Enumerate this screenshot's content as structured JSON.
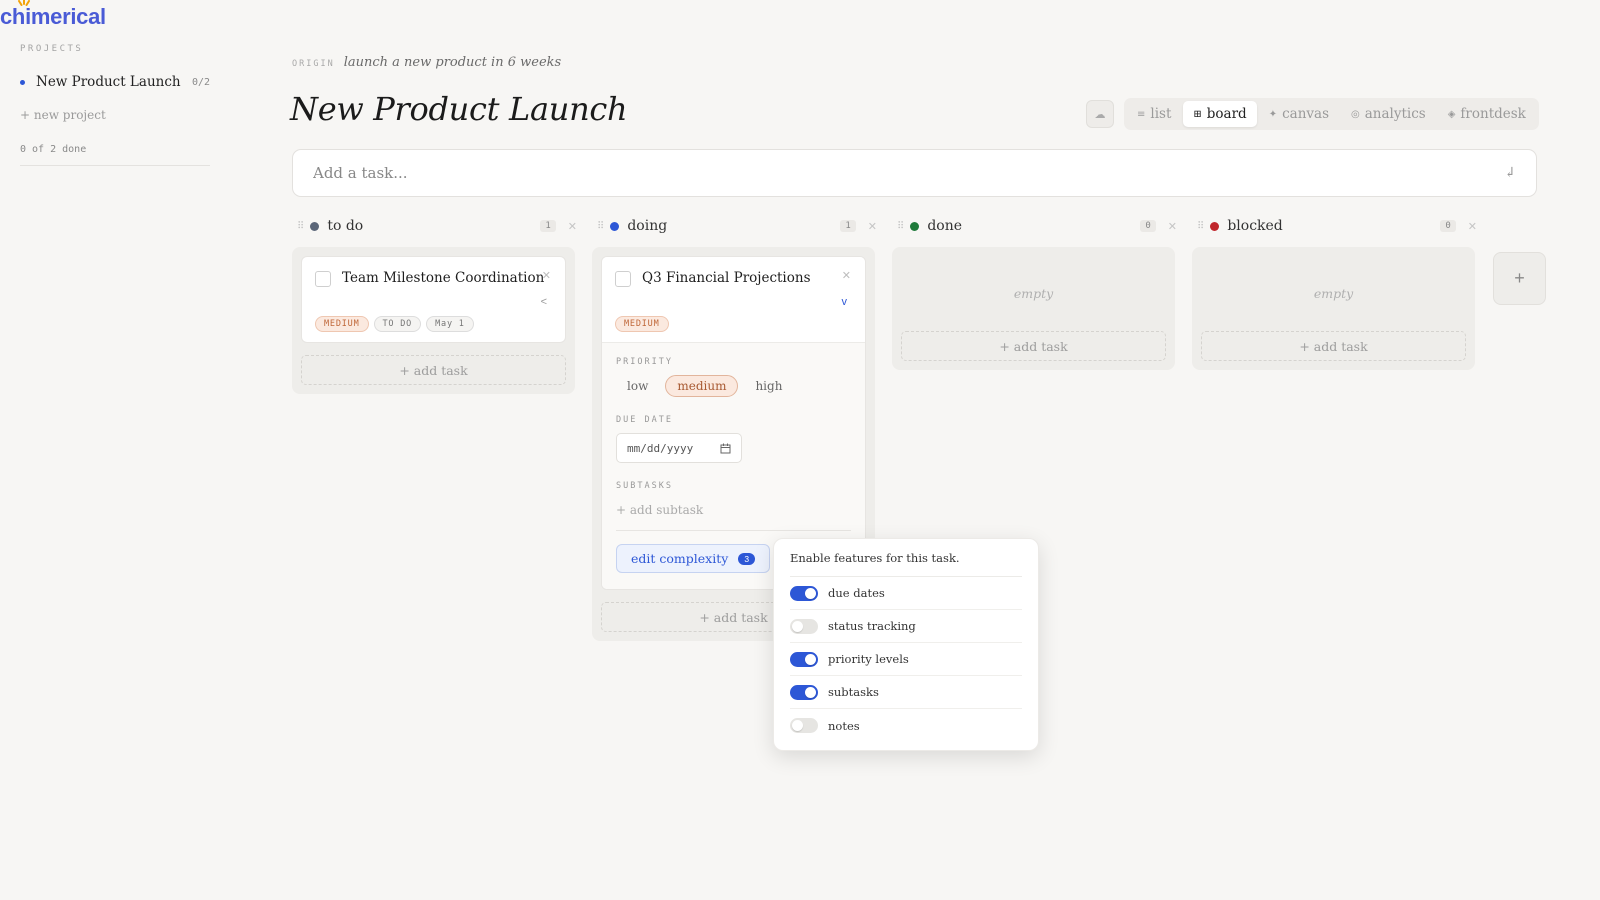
{
  "app": {
    "logo": "chimerical"
  },
  "sidebar": {
    "heading": "PROJECTS",
    "projects": [
      {
        "name": "New Product Launch",
        "count": "0/2"
      }
    ],
    "new_project": "+ new project",
    "done_summary": "0 of 2 done"
  },
  "header": {
    "origin_label": "ORIGIN",
    "origin_text": "launch a new product in 6 weeks",
    "title": "New Product Launch"
  },
  "views": [
    {
      "label": "list",
      "icon": "list-icon",
      "glyph": "≡"
    },
    {
      "label": "board",
      "icon": "board-icon",
      "glyph": "⊞",
      "active": true
    },
    {
      "label": "canvas",
      "icon": "canvas-icon",
      "glyph": "✦"
    },
    {
      "label": "analytics",
      "icon": "analytics-icon",
      "glyph": "◎"
    },
    {
      "label": "frontdesk",
      "icon": "frontdesk-icon",
      "glyph": "◈"
    }
  ],
  "add_task": {
    "placeholder": "Add a task...",
    "submit_glyph": "↲"
  },
  "columns": [
    {
      "name": "to do",
      "count": "1",
      "color": "#5b6678"
    },
    {
      "name": "doing",
      "count": "1",
      "color": "#2d57d6"
    },
    {
      "name": "done",
      "count": "0",
      "color": "#1f7a3a"
    },
    {
      "name": "blocked",
      "count": "0",
      "color": "#c0262b"
    }
  ],
  "cards": {
    "todo": {
      "title": "Team Milestone Coordination",
      "tags": [
        "MEDIUM",
        "TO DO",
        "May 1"
      ]
    },
    "doing": {
      "title": "Q3 Financial Projections",
      "tags": [
        "MEDIUM"
      ],
      "details": {
        "priority_label": "PRIORITY",
        "priority_options": [
          "low",
          "medium",
          "high"
        ],
        "priority_selected": "medium",
        "due_date_label": "DUE DATE",
        "due_date_placeholder": "mm/dd/yyyy",
        "subtasks_label": "SUBTASKS",
        "add_subtask": "+ add subtask",
        "edit_complexity": "edit complexity",
        "complexity_count": "3"
      }
    }
  },
  "empty_label": "empty",
  "add_task_label": "+ add task",
  "add_column": "+",
  "features_popover": {
    "title": "Enable features for this task.",
    "toggles": [
      {
        "label": "due dates",
        "on": true
      },
      {
        "label": "status tracking",
        "on": false
      },
      {
        "label": "priority levels",
        "on": true
      },
      {
        "label": "subtasks",
        "on": true
      },
      {
        "label": "notes",
        "on": false
      }
    ]
  }
}
